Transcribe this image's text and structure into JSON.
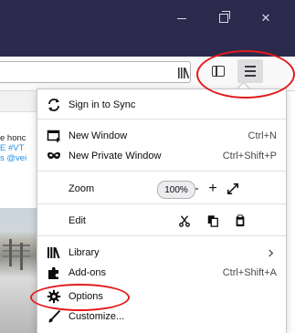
{
  "window": {
    "minimize_label": "–",
    "maximize_label": "",
    "close_label": "✕"
  },
  "page": {
    "line1": "e honc",
    "line2": "E #VT",
    "line3": "s @vei"
  },
  "menu": {
    "sync": {
      "label": "Sign in to Sync"
    },
    "new_window": {
      "label": "New Window",
      "shortcut": "Ctrl+N"
    },
    "new_private_window": {
      "label": "New Private Window",
      "shortcut": "Ctrl+Shift+P"
    },
    "zoom": {
      "label": "Zoom",
      "minus": "—",
      "value": "100%",
      "plus": "+"
    },
    "edit": {
      "label": "Edit"
    },
    "library": {
      "label": "Library"
    },
    "addons": {
      "label": "Add-ons",
      "shortcut": "Ctrl+Shift+A"
    },
    "options": {
      "label": "Options"
    },
    "customize": {
      "label": "Customize..."
    }
  },
  "colors": {
    "titlebar": "#2b2a4c",
    "annotation_ring": "#e41b1b",
    "link": "#1d8ee6"
  },
  "icons": [
    "library-icon",
    "sidebar-icon",
    "hamburger-menu-icon",
    "sync-icon",
    "new-window-icon",
    "private-window-mask-icon",
    "fullscreen-icon",
    "cut-icon",
    "copy-icon",
    "paste-icon",
    "library-books-icon",
    "puzzle-piece-icon",
    "gear-icon",
    "paintbrush-icon",
    "chevron-right-icon"
  ]
}
